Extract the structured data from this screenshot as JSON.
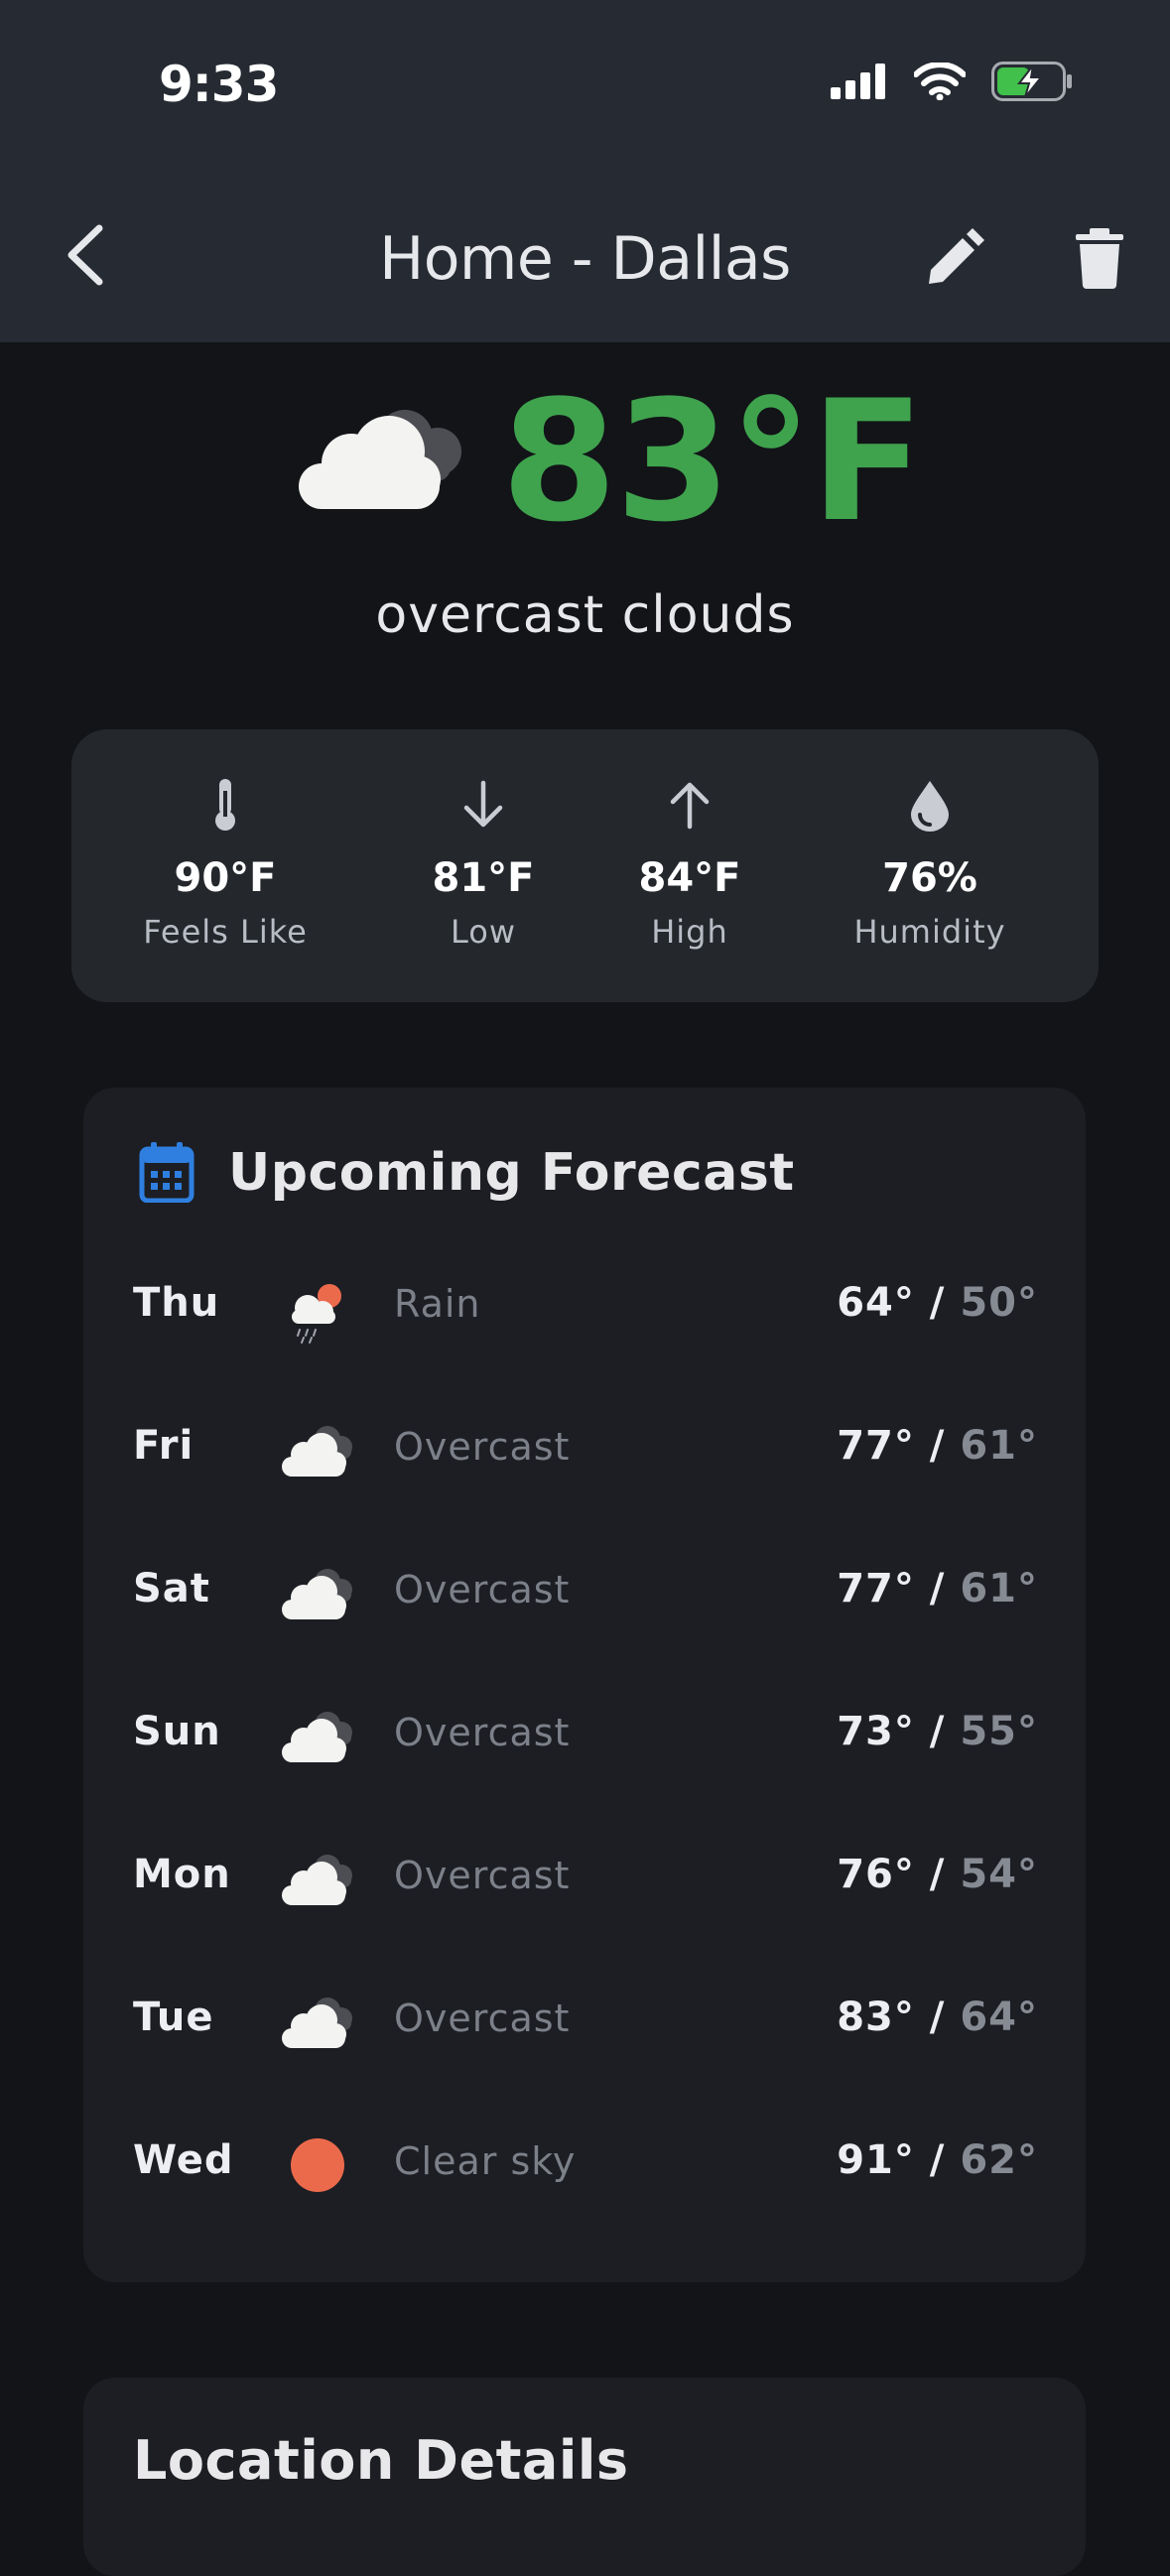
{
  "status_bar": {
    "time": "9:33",
    "icons": [
      "cellular-signal-icon",
      "wifi-icon",
      "battery-charging-icon"
    ]
  },
  "nav": {
    "title": "Home - Dallas",
    "back_icon": "chevron-left-icon",
    "edit_icon": "pencil-icon",
    "delete_icon": "trash-icon"
  },
  "current": {
    "temperature": "83°F",
    "description": "overcast clouds",
    "icon": "overcast-cloud-icon",
    "temp_color": "#3fa34d"
  },
  "stats": [
    {
      "icon": "thermometer-icon",
      "value": "90°F",
      "label": "Feels Like"
    },
    {
      "icon": "arrow-down-icon",
      "value": "81°F",
      "label": "Low"
    },
    {
      "icon": "arrow-up-icon",
      "value": "84°F",
      "label": "High"
    },
    {
      "icon": "water-drop-icon",
      "value": "76%",
      "label": "Humidity"
    }
  ],
  "forecast": {
    "title": "Upcoming Forecast",
    "icon": "calendar-icon",
    "days": [
      {
        "day": "Thu",
        "icon": "rain-icon",
        "condition": "Rain",
        "high": "64°",
        "low": "50°"
      },
      {
        "day": "Fri",
        "icon": "overcast-icon",
        "condition": "Overcast",
        "high": "77°",
        "low": "61°"
      },
      {
        "day": "Sat",
        "icon": "overcast-icon",
        "condition": "Overcast",
        "high": "77°",
        "low": "61°"
      },
      {
        "day": "Sun",
        "icon": "overcast-icon",
        "condition": "Overcast",
        "high": "73°",
        "low": "55°"
      },
      {
        "day": "Mon",
        "icon": "overcast-icon",
        "condition": "Overcast",
        "high": "76°",
        "low": "54°"
      },
      {
        "day": "Tue",
        "icon": "overcast-icon",
        "condition": "Overcast",
        "high": "83°",
        "low": "64°"
      },
      {
        "day": "Wed",
        "icon": "clear-sky-icon",
        "condition": "Clear sky",
        "high": "91°",
        "low": "62°"
      }
    ]
  },
  "location_details": {
    "title": "Location Details"
  },
  "colors": {
    "accent_blue": "#2f7fe0",
    "sun": "#ec6a4c",
    "background": "#121418",
    "header": "#262b33"
  }
}
